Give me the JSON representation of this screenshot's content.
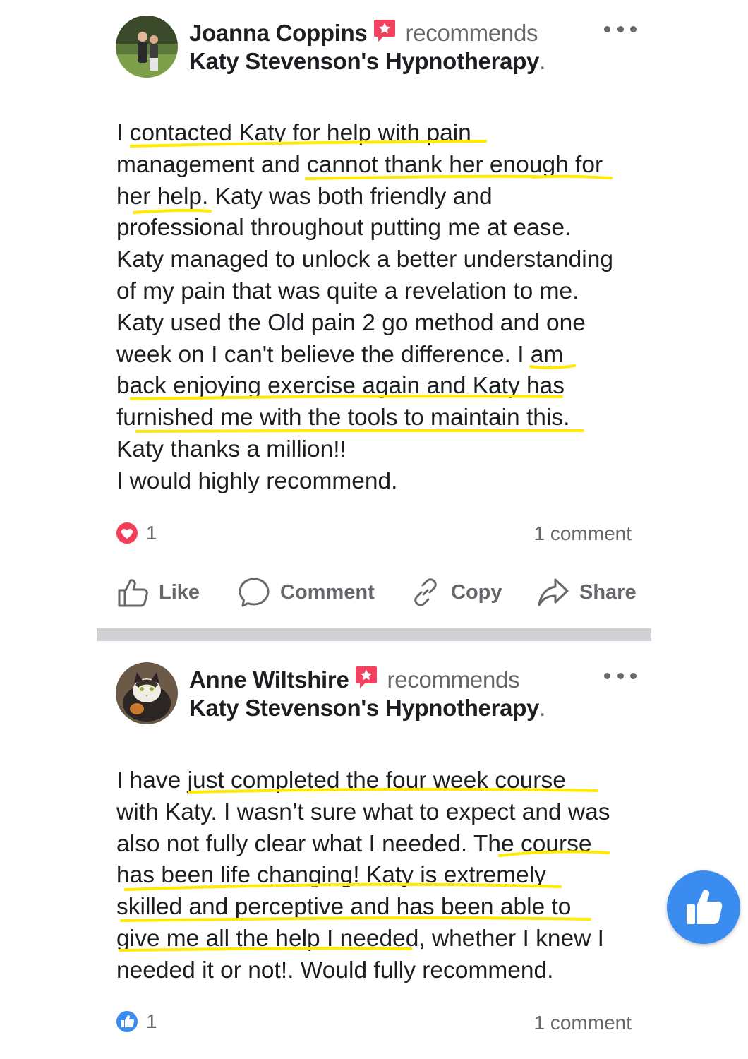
{
  "posts": [
    {
      "author": "Joanna Coppins",
      "verb": "recommends",
      "page": "Katy Stevenson's Hypnotherapy",
      "page_suffix": ".",
      "body_lines": [
        "I contacted Katy for help with pain",
        "management and cannot thank her enough for",
        "her help. Katy was both friendly and",
        "professional throughout putting me at ease.",
        "Katy managed to unlock a better understanding",
        "of my pain that was quite a revelation to me.",
        "Katy used the Old pain 2 go method and one",
        "week on I can't believe the difference. I am",
        "back enjoying exercise again and Katy has",
        "furnished me with the tools to maintain this.",
        "Katy thanks a million!!",
        "I would highly recommend."
      ],
      "reaction_icon": "heart-reaction-icon",
      "reaction_count": "1",
      "comments": "1 comment",
      "actions": {
        "like": "Like",
        "comment": "Comment",
        "copy": "Copy",
        "share": "Share"
      }
    },
    {
      "author": "Anne Wiltshire",
      "verb": "recommends",
      "page": "Katy Stevenson's Hypnotherapy",
      "page_suffix": ".",
      "body_lines": [
        "I have just completed the four week course",
        "with Katy. I wasn’t sure what to expect and was",
        "also not fully clear what I needed. The course",
        "has been life changing! Katy is extremely",
        "skilled and perceptive and has been able to",
        "give me all the help I needed, whether I knew I",
        "needed it or not!. Would fully recommend."
      ],
      "reaction_icon": "like-reaction-icon",
      "reaction_count": "1",
      "comments": "1 comment"
    }
  ],
  "colors": {
    "highlight": "#ffea00",
    "like_blue": "#3a8cf0",
    "heart_red": "#f33e58",
    "recommend_badge": "#f3425f",
    "muted": "#65676b",
    "divider": "#cfd1d4"
  },
  "floating_button_icon": "thumbs-up-icon"
}
